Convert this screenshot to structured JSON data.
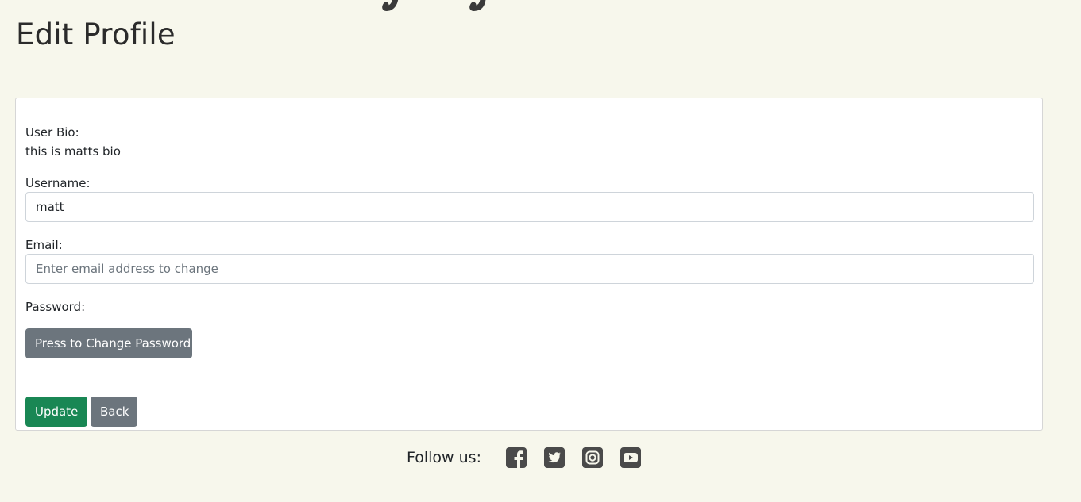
{
  "page": {
    "title": "Edit Profile"
  },
  "form": {
    "bio_label": "User Bio:",
    "bio_text": "this is matts bio",
    "username_label": "Username:",
    "username_value": "matt",
    "email_label": "Email:",
    "email_placeholder": "Enter email address to change",
    "password_label": "Password:",
    "change_password_button": "Press to Change Password",
    "update_button": "Update",
    "back_button": "Back"
  },
  "footer": {
    "follow_label": "Follow us:",
    "social_icons": [
      "facebook-icon",
      "twitter-icon",
      "instagram-icon",
      "youtube-icon"
    ]
  },
  "colors": {
    "background": "#f7f7ec",
    "success": "#198754",
    "secondary": "#6c757d",
    "social_icon": "#4a4a4a"
  }
}
